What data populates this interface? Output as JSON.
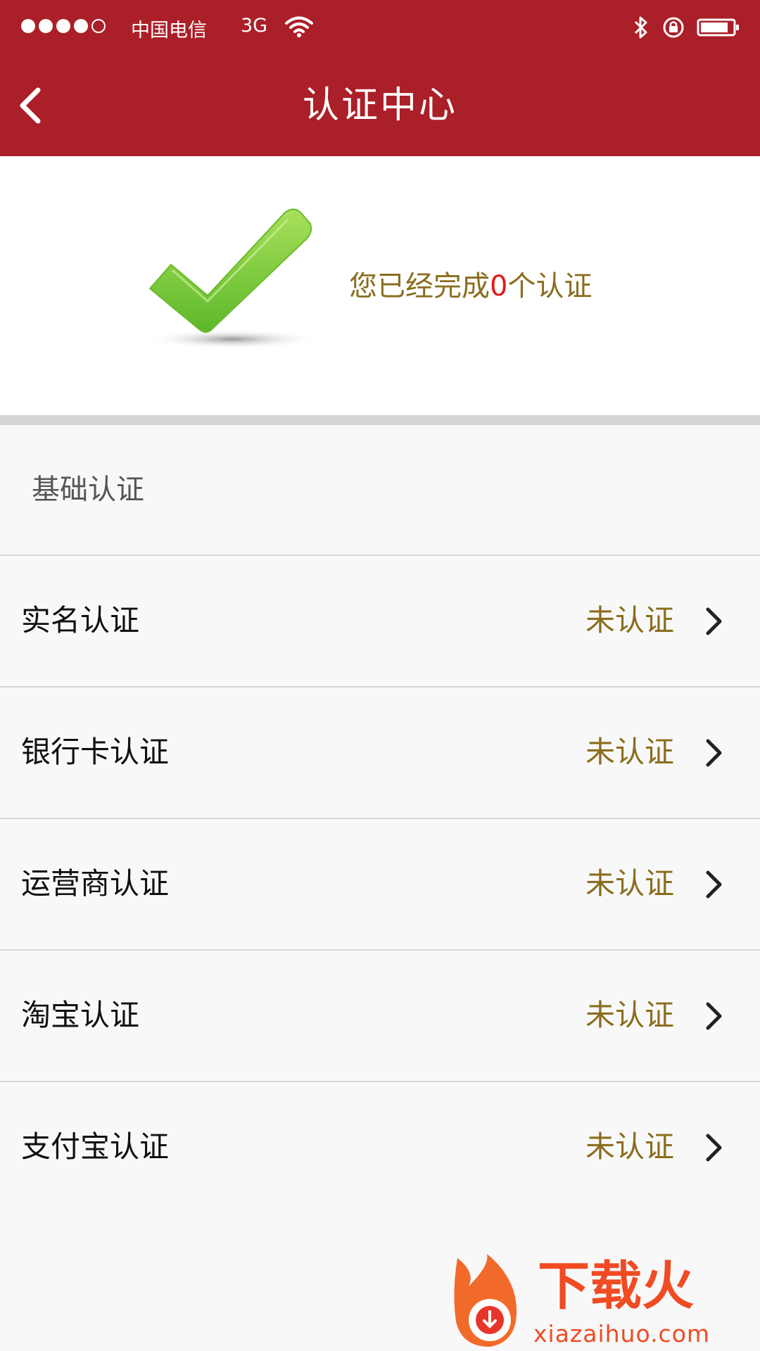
{
  "status_bar": {
    "carrier": "中国电信",
    "network": "3G",
    "signal_bars_filled": 4,
    "signal_bars_total": 5
  },
  "nav": {
    "title": "认证中心",
    "back_icon": "chevron-left-icon"
  },
  "summary": {
    "prefix": "您已经完成",
    "count": "0",
    "suffix": "个认证",
    "icon": "checkmark-icon"
  },
  "section": {
    "title": "基础认证"
  },
  "items": [
    {
      "label": "实名认证",
      "status": "未认证"
    },
    {
      "label": "银行卡认证",
      "status": "未认证"
    },
    {
      "label": "运营商认证",
      "status": "未认证"
    },
    {
      "label": "淘宝认证",
      "status": "未认证"
    },
    {
      "label": "支付宝认证",
      "status": "未认证"
    }
  ],
  "watermark": {
    "text": "下载火",
    "url": "xiazaihuo.com"
  },
  "colors": {
    "header": "#ab1f28",
    "status_text": "#8a6d1e",
    "count": "#e21a1a",
    "check_green": "#7ccf2a"
  }
}
